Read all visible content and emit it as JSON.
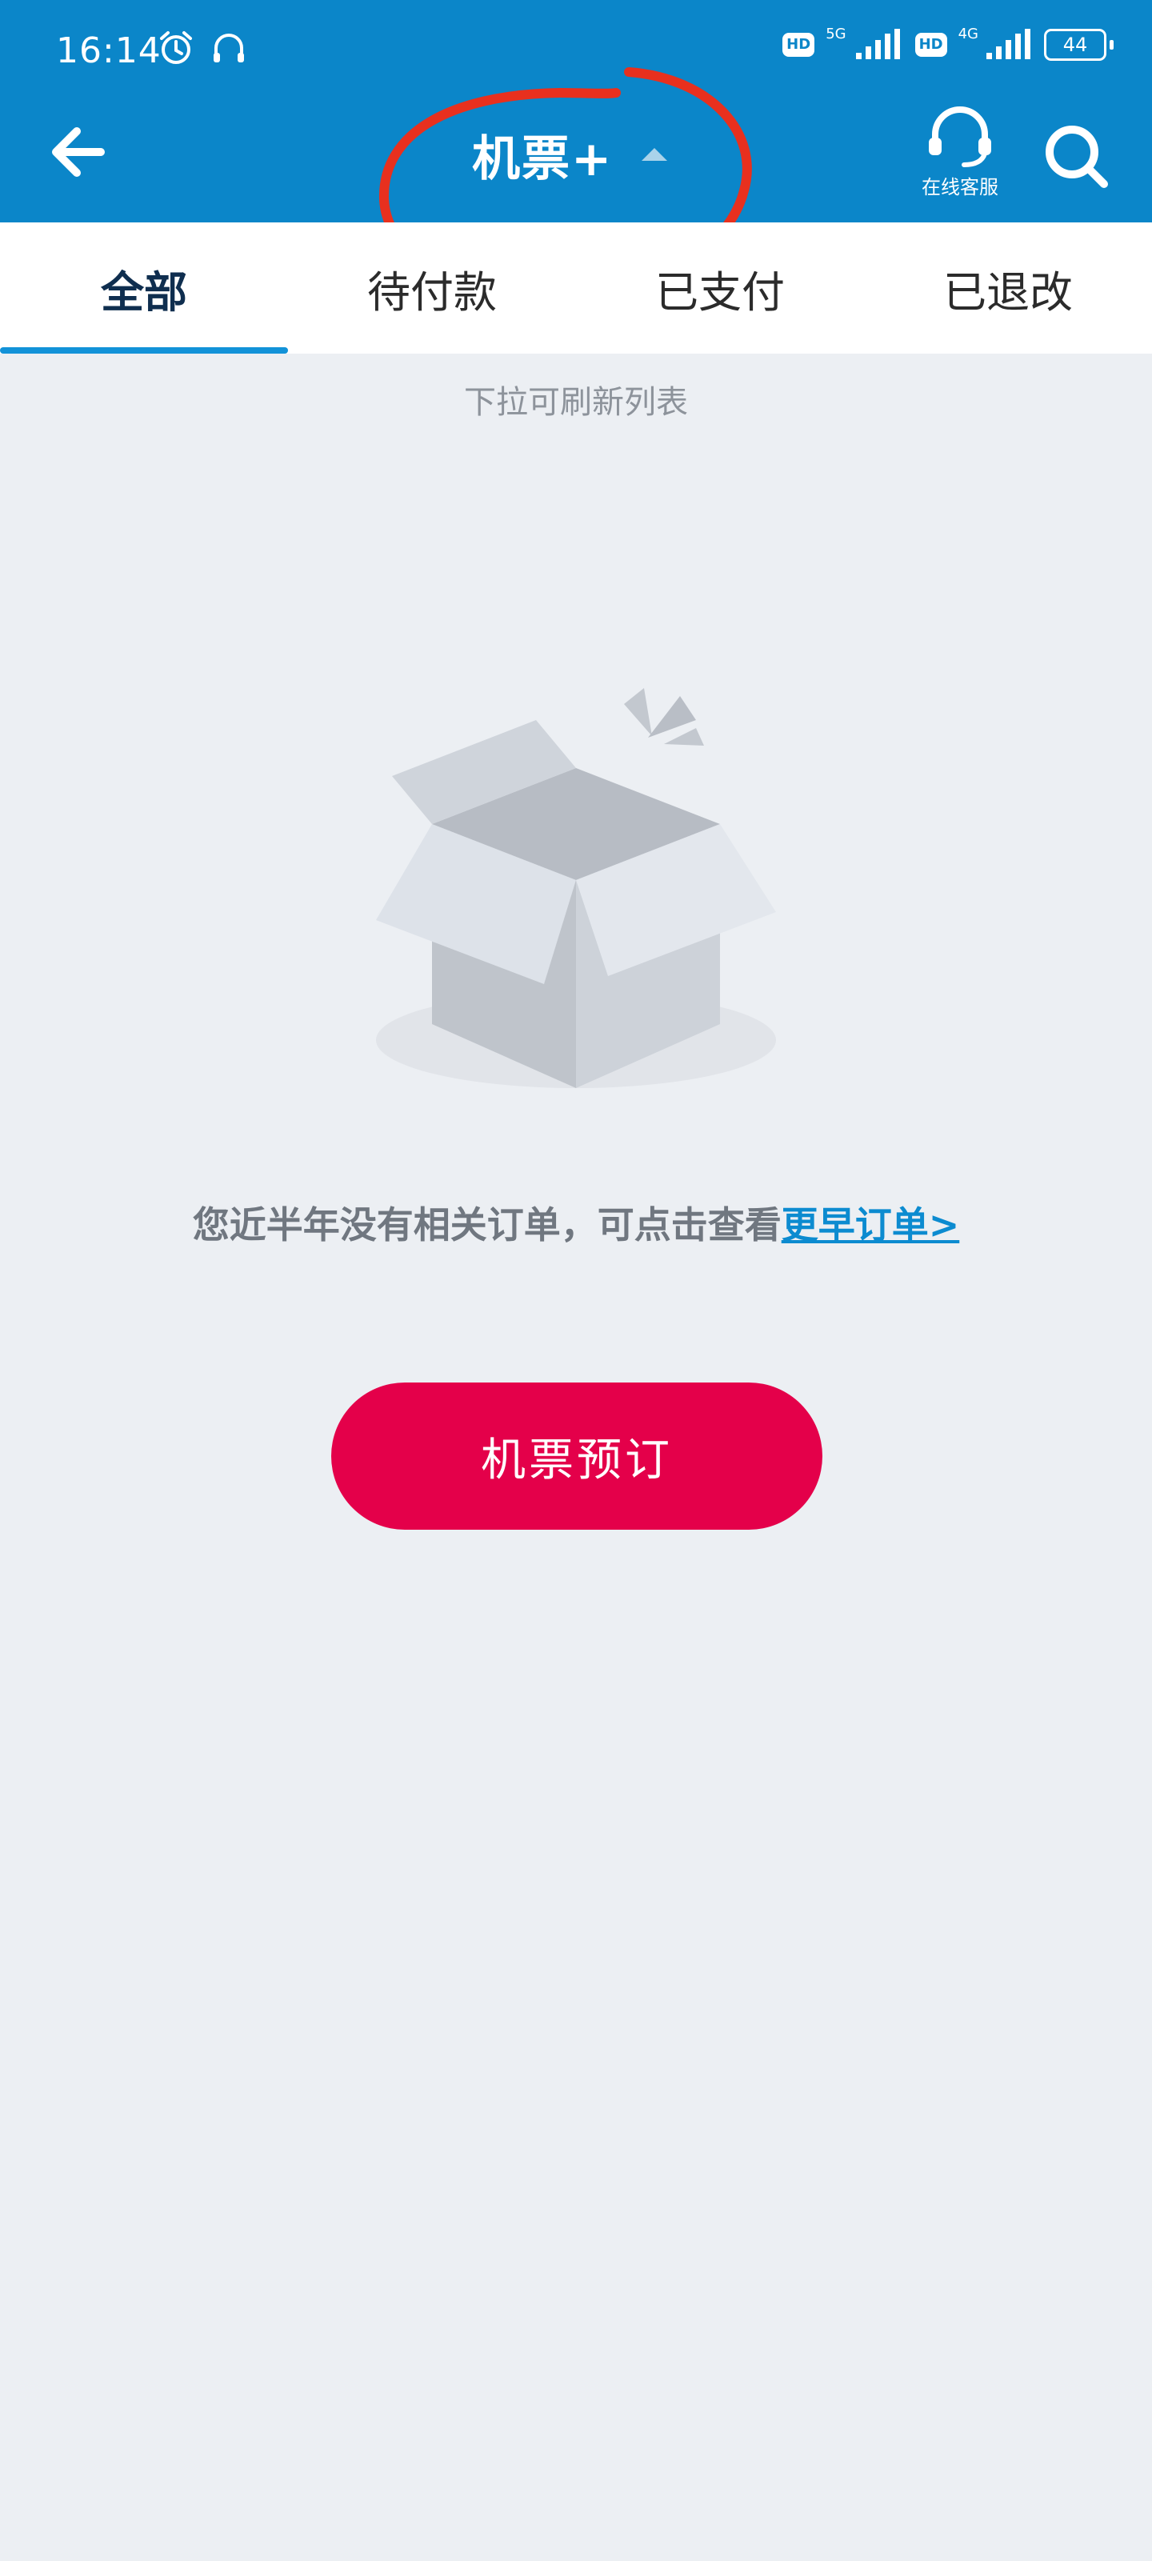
{
  "status_bar": {
    "time": "16:14",
    "hd_label": "HD",
    "net_5g": "5G",
    "net_4g": "4G",
    "battery": "44"
  },
  "header": {
    "title": "机票+",
    "customer_service_label": "在线客服",
    "annotation_color": "#e8301e"
  },
  "tabs": [
    {
      "label": "全部"
    },
    {
      "label": "待付款"
    },
    {
      "label": "已支付"
    },
    {
      "label": "已退改"
    }
  ],
  "content": {
    "pull_hint": "下拉可刷新列表",
    "empty_message": "您近半年没有相关订单，可点击查看",
    "earlier_orders_link": "更早订单>",
    "book_button": "机票预订"
  },
  "colors": {
    "header_bg": "#0b86c9",
    "accent": "#1292d8",
    "book_button": "#e4004a"
  }
}
